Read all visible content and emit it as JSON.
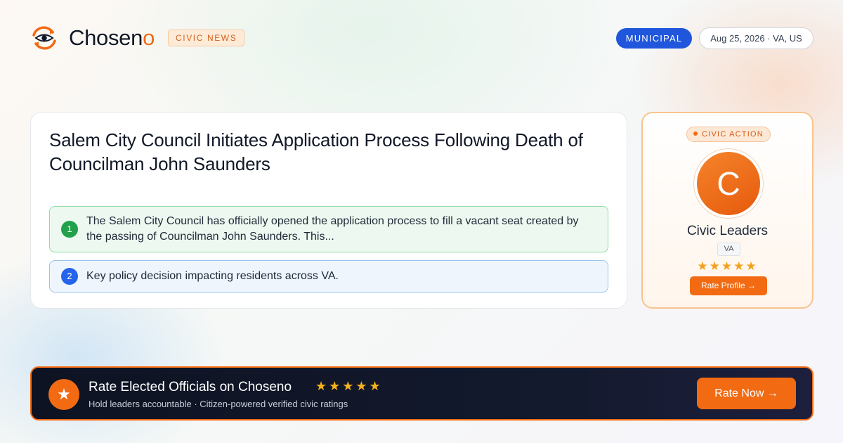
{
  "header": {
    "brand_main": "Chosen",
    "brand_accent": "o",
    "section_badge": "CIVIC NEWS",
    "category_pill": "MUNICIPAL",
    "date_location": "Aug 25, 2026 · VA, US"
  },
  "article": {
    "headline": "Salem City Council Initiates Application Process Following Death of Councilman John Saunders",
    "points": [
      {
        "number": "1",
        "text": "The Salem City Council has officially opened the application process to fill a vacant seat created by the passing of Councilman John Saunders. This..."
      },
      {
        "number": "2",
        "text": "Key policy decision impacting residents across VA."
      }
    ]
  },
  "profile_card": {
    "badge": "CIVIC ACTION",
    "avatar_initial": "C",
    "name": "Civic Leaders",
    "state": "VA",
    "stars": "★★★★★",
    "button_label": "Rate Profile →"
  },
  "banner": {
    "icon": "★",
    "title": "Rate Elected Officials on Choseno",
    "stars": "★★★★★",
    "subtitle": "Hold leaders accountable · Citizen-powered verified civic ratings",
    "button_label": "Rate Now →"
  },
  "colors": {
    "accent": "#f26a12",
    "municipal": "#1f56dc",
    "banner_bg": "#0d1322",
    "star": "#f2a11b"
  },
  "icons": {
    "logo": "eye-refresh-icon",
    "banner": "star-icon"
  }
}
